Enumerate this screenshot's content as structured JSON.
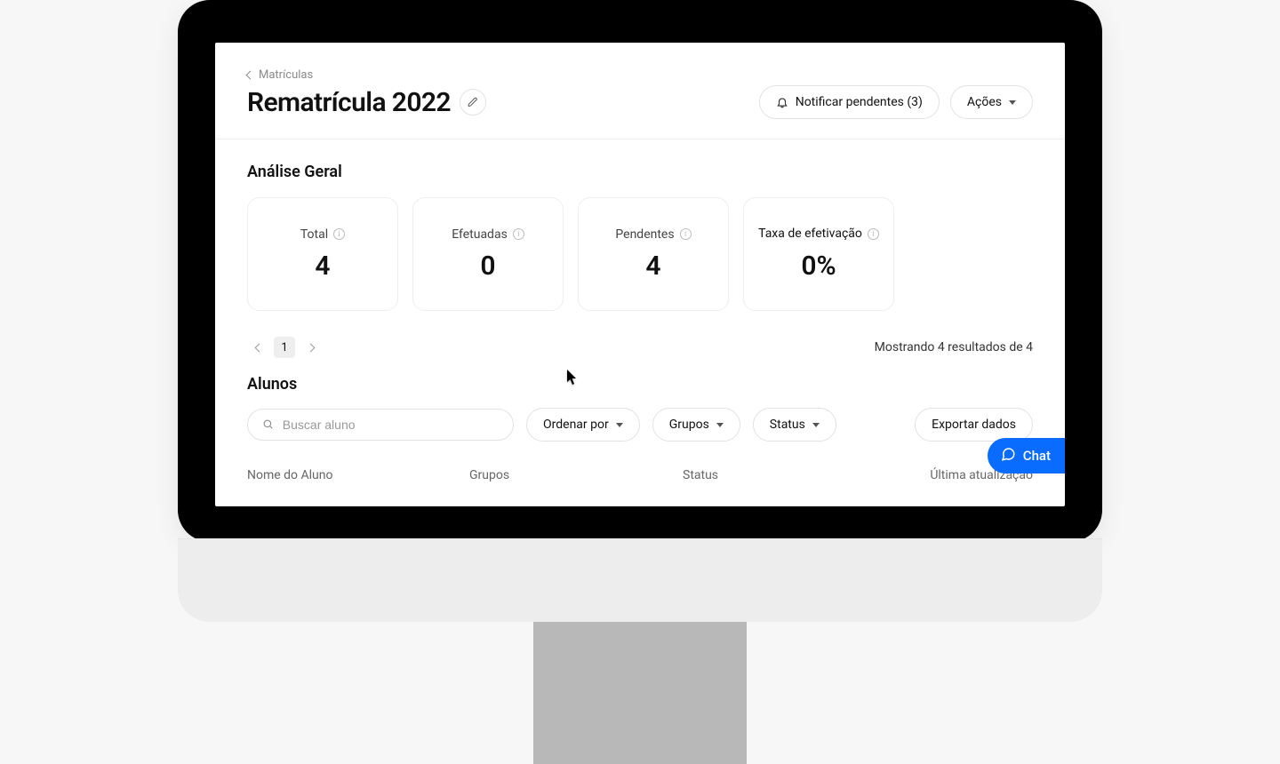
{
  "breadcrumb": {
    "label": "Matrículas"
  },
  "page": {
    "title": "Rematrícula 2022"
  },
  "header": {
    "notify_label": "Notificar pendentes (3)",
    "actions_label": "Ações"
  },
  "analysis": {
    "title": "Análise Geral",
    "cards": [
      {
        "label": "Total",
        "value": "4"
      },
      {
        "label": "Efetuadas",
        "value": "0"
      },
      {
        "label": "Pendentes",
        "value": "4"
      },
      {
        "label": "Taxa de efetivação",
        "value": "0%"
      }
    ]
  },
  "pagination": {
    "current": "1",
    "results_text": "Mostrando 4 resultados de 4"
  },
  "students": {
    "title": "Alunos",
    "search_placeholder": "Buscar aluno",
    "sort_label": "Ordenar por",
    "groups_label": "Grupos",
    "status_label": "Status",
    "export_label": "Exportar dados",
    "columns": {
      "name": "Nome do Aluno",
      "groups": "Grupos",
      "status": "Status",
      "updated": "Última atualização"
    }
  },
  "chat": {
    "label": "Chat"
  }
}
